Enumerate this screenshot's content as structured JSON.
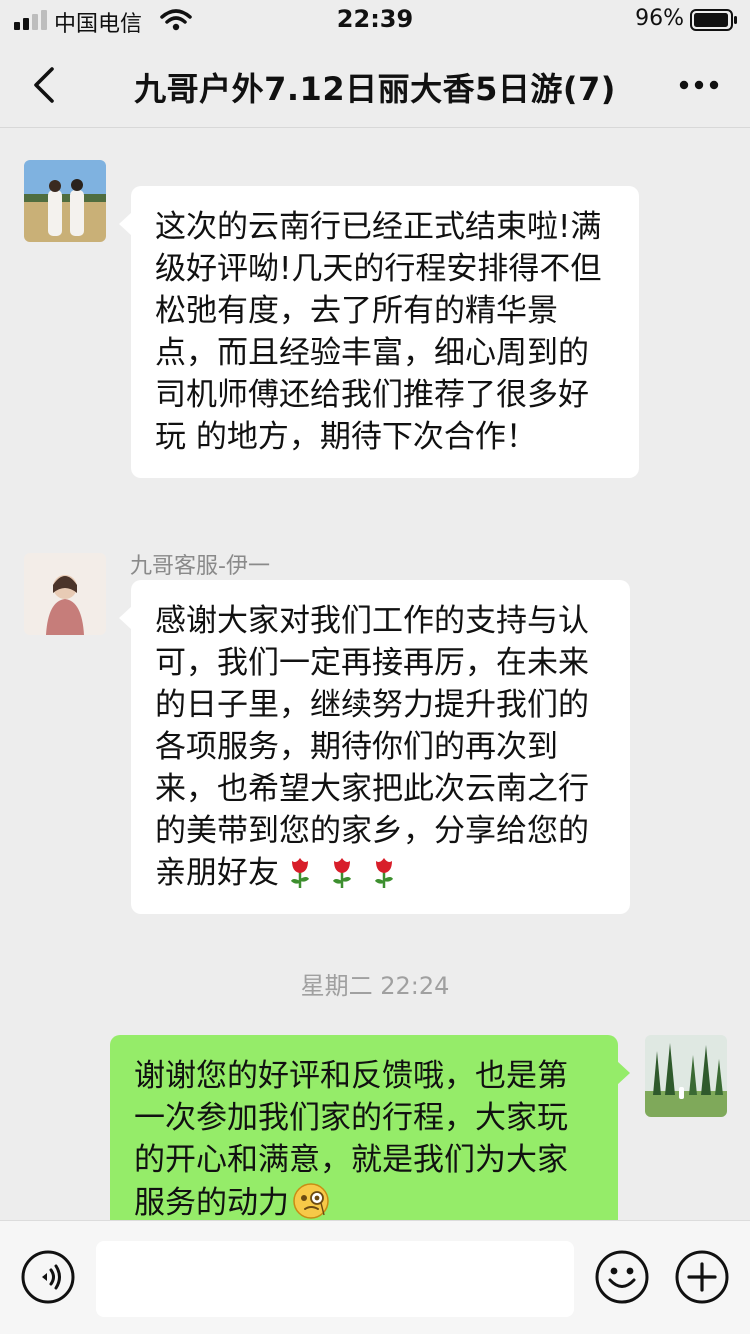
{
  "status_bar": {
    "carrier": "中国电信",
    "time": "22:39",
    "battery": "96%"
  },
  "nav": {
    "title": "九哥户外7.12日丽大香5日游(7)"
  },
  "messages": [
    {
      "direction": "incoming",
      "sender": "",
      "avatar_icon": "couple-photo-avatar",
      "text": "这次的云南行已经正式结束啦!满级好评呦!几天的行程安排得不但松弛有度，去了所有的精华景点，而且经验丰富，细心周到的司机师傅还给我们推荐了很多好玩 的地方，期待下次合作！"
    },
    {
      "direction": "incoming",
      "sender": "九哥客服-伊一",
      "avatar_icon": "woman-photo-avatar",
      "text": "感谢大家对我们工作的支持与认可，我们一定再接再厉，在未来的日子里，继续努力提升我们的各项服务，期待你们的再次到来，也希望大家把此次云南之行的美带到您的家乡，分享给您的亲朋好友",
      "emoji": [
        "rose",
        "rose",
        "rose"
      ]
    },
    {
      "type": "timestamp",
      "text": "星期二 22:24"
    },
    {
      "direction": "outgoing",
      "avatar_icon": "landscape-photo-avatar",
      "text": "谢谢您的好评和反馈哦，也是第一次参加我们家的行程，大家玩的开心和满意，就是我们为大家服务的动力",
      "emoji": [
        "face-with-monocle"
      ]
    }
  ],
  "input_bar": {
    "value": "",
    "icons": [
      "voice-icon",
      "emoji-icon",
      "plus-icon"
    ]
  },
  "colors": {
    "background": "#ededed",
    "incoming_bubble": "#ffffff",
    "outgoing_bubble": "#95ec69"
  }
}
